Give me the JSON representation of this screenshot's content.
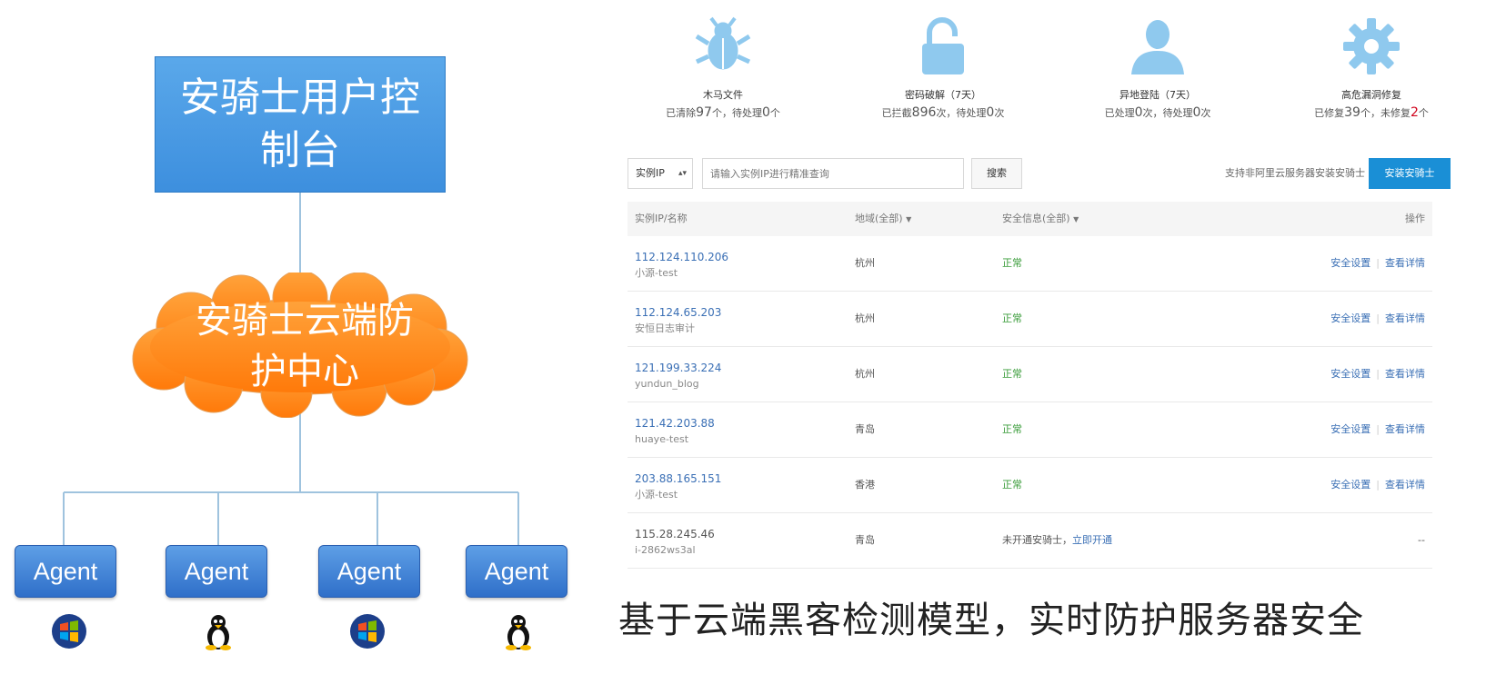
{
  "diagram": {
    "console_label": "安骑士用户控制台",
    "cloud_label": "安骑士云端防护中心",
    "agents": [
      {
        "label": "Agent",
        "os": "windows-icon"
      },
      {
        "label": "Agent",
        "os": "linux-icon"
      },
      {
        "label": "Agent",
        "os": "windows-icon"
      },
      {
        "label": "Agent",
        "os": "linux-icon"
      }
    ]
  },
  "stats": [
    {
      "icon": "bug-icon",
      "title": "木马文件",
      "prefix": "已清除",
      "num1": "97",
      "mid": "个，待处理",
      "num2": "0",
      "suffix": "个"
    },
    {
      "icon": "lock-icon",
      "title": "密码破解（7天）",
      "prefix": "已拦截",
      "num1": "896",
      "mid": "次，待处理",
      "num2": "0",
      "suffix": "次"
    },
    {
      "icon": "user-icon",
      "title": "异地登陆（7天）",
      "prefix": "已处理",
      "num1": "0",
      "mid": "次，待处理",
      "num2": "0",
      "suffix": "次"
    },
    {
      "icon": "gear-icon",
      "title": "高危漏洞修复",
      "prefix": "已修复",
      "num1": "39",
      "mid": "个，未修复",
      "num2": "2",
      "suffix": "个"
    }
  ],
  "toolbar": {
    "select_value": "实例IP",
    "search_placeholder": "请输入实例IP进行精准查询",
    "search_label": "搜索",
    "support_text": "支持非阿里云服务器安装安骑士",
    "install_label": "安装安骑士"
  },
  "table": {
    "headers": {
      "ip": "实例IP/名称",
      "region": "地域(全部)",
      "security": "安全信息(全部)",
      "ops": "操作"
    },
    "rows": [
      {
        "ip": "112.124.110.206",
        "name": "小源-test",
        "region": "杭州",
        "status": "正常",
        "op1": "安全设置",
        "op2": "查看详情"
      },
      {
        "ip": "112.124.65.203",
        "name": "安恒日志审计",
        "region": "杭州",
        "status": "正常",
        "op1": "安全设置",
        "op2": "查看详情"
      },
      {
        "ip": "121.199.33.224",
        "name": "yundun_blog",
        "region": "杭州",
        "status": "正常",
        "op1": "安全设置",
        "op2": "查看详情"
      },
      {
        "ip": "121.42.203.88",
        "name": "huaye-test",
        "region": "青岛",
        "status": "正常",
        "op1": "安全设置",
        "op2": "查看详情"
      },
      {
        "ip": "203.88.165.151",
        "name": "小源-test",
        "region": "香港",
        "status": "正常",
        "op1": "安全设置",
        "op2": "查看详情"
      }
    ],
    "last_row": {
      "ip": "115.28.245.46",
      "name": "i-2862ws3al",
      "region": "青岛",
      "status_text": "未开通安骑士，",
      "status_link": "立即开通",
      "op": "--"
    }
  },
  "caption": "基于云端黑客检测模型，实时防护服务器安全",
  "colors": {
    "accent": "#1a8fd6",
    "icon": "#8fc9ee",
    "cloud": "#ff8a1c",
    "console_box": "#4a9be6",
    "danger": "#d0021b"
  }
}
